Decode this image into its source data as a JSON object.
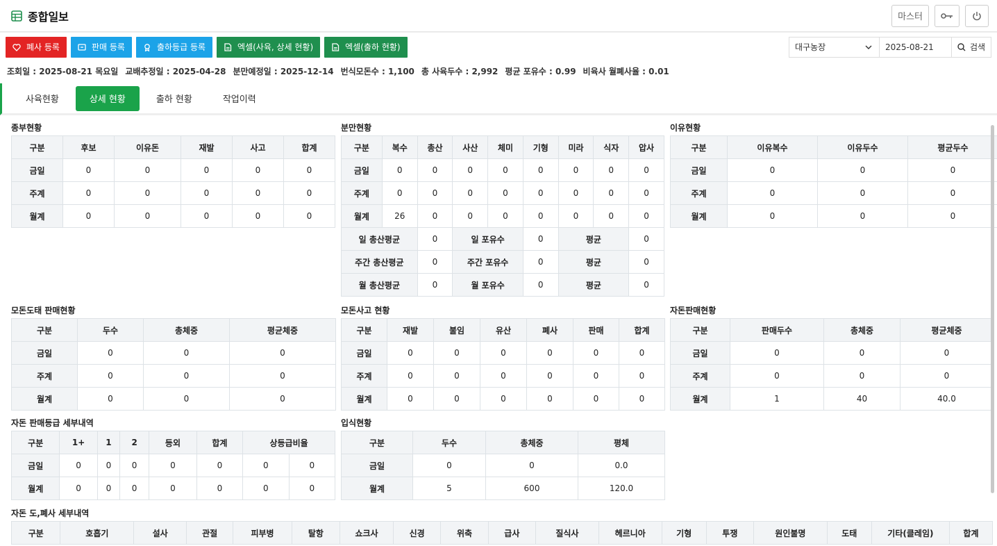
{
  "app": {
    "title": "종합일보"
  },
  "topbar": {
    "master": "마스터"
  },
  "actions": [
    {
      "label": "폐사 등록",
      "color": "#e32424",
      "icon": "heart-icon"
    },
    {
      "label": "판매 등록",
      "color": "#1ca3e8",
      "icon": "sale-icon"
    },
    {
      "label": "출하등급 등록",
      "color": "#1ca3e8",
      "icon": "badge-icon"
    },
    {
      "label": "엑셀(사육, 상세 현황)",
      "color": "#1f8f4e",
      "icon": "excel-icon"
    },
    {
      "label": "엑셀(출하 현황)",
      "color": "#1f8f4e",
      "icon": "excel-icon"
    }
  ],
  "search": {
    "farm": "대구농장",
    "date": "2025-08-21",
    "button": "검색"
  },
  "info": [
    "조회일 : 2025-08-21 목요일",
    "교배추정일 : 2025-04-28",
    "분만예정일 : 2025-12-14",
    "번식모돈수 : 1,100",
    "총 사육두수 : 2,992",
    "평균 포유수 : 0.99",
    "비육사 월폐사율 : 0.01"
  ],
  "tabs": [
    "사육현황",
    "상세 현황",
    "출하 현황",
    "작업이력"
  ],
  "tables": {
    "t1": {
      "title": "종부현황",
      "head": [
        "구분",
        "후보",
        "이유돈",
        "재발",
        "사고",
        "합계"
      ],
      "rows": [
        [
          "금일",
          "0",
          "0",
          "0",
          "0",
          "0"
        ],
        [
          "주계",
          "0",
          "0",
          "0",
          "0",
          "0"
        ],
        [
          "월계",
          "0",
          "0",
          "0",
          "0",
          "0"
        ]
      ]
    },
    "t2": {
      "title": "분만현황",
      "head": [
        "구분",
        "복수",
        "총산",
        "사산",
        "체미",
        "기형",
        "미라",
        "식자",
        "압사"
      ],
      "rows": [
        [
          "금일",
          "0",
          "0",
          "0",
          "0",
          "0",
          "0",
          "0",
          "0"
        ],
        [
          "주계",
          "0",
          "0",
          "0",
          "0",
          "0",
          "0",
          "0",
          "0"
        ],
        [
          "월계",
          "26",
          "0",
          "0",
          "0",
          "0",
          "0",
          "0",
          "0"
        ]
      ],
      "extra": [
        [
          "일 총산평균",
          "0",
          "일 포유수",
          "0",
          "평균",
          "0"
        ],
        [
          "주간 총산평균",
          "0",
          "주간 포유수",
          "0",
          "평균",
          "0"
        ],
        [
          "월 총산평균",
          "0",
          "월 포유수",
          "0",
          "평균",
          "0"
        ]
      ]
    },
    "t3": {
      "title": "이유현황",
      "head": [
        "구분",
        "이유복수",
        "이유두수",
        "평균두수"
      ],
      "rows": [
        [
          "금일",
          "0",
          "0",
          "0"
        ],
        [
          "주계",
          "0",
          "0",
          "0"
        ],
        [
          "월계",
          "0",
          "0",
          "0"
        ]
      ]
    },
    "t4": {
      "title": "모돈도태 판매현황",
      "head": [
        "구분",
        "두수",
        "총체중",
        "평균체중"
      ],
      "rows": [
        [
          "금일",
          "0",
          "0",
          "0"
        ],
        [
          "주계",
          "0",
          "0",
          "0"
        ],
        [
          "월계",
          "0",
          "0",
          "0"
        ]
      ]
    },
    "t5": {
      "title": "모돈사고 현황",
      "head": [
        "구분",
        "재발",
        "불임",
        "유산",
        "폐사",
        "판매",
        "합계"
      ],
      "rows": [
        [
          "금일",
          "0",
          "0",
          "0",
          "0",
          "0",
          "0"
        ],
        [
          "주계",
          "0",
          "0",
          "0",
          "0",
          "0",
          "0"
        ],
        [
          "월계",
          "0",
          "0",
          "0",
          "0",
          "0",
          "0"
        ]
      ]
    },
    "t6": {
      "title": "자돈판매현황",
      "head": [
        "구분",
        "판매두수",
        "총체중",
        "평균체중"
      ],
      "rows": [
        [
          "금일",
          "0",
          "0",
          "0"
        ],
        [
          "주계",
          "0",
          "0",
          "0"
        ],
        [
          "월계",
          "1",
          "40",
          "40.0"
        ]
      ]
    },
    "t7": {
      "title": "자돈 판매등급 세부내역",
      "head": [
        "구분",
        "1+",
        "1",
        "2",
        "등외",
        "합계",
        "상등급비율"
      ],
      "rows": [
        [
          "금일",
          "0",
          "0",
          "0",
          "0",
          "0",
          "0",
          "0"
        ],
        [
          "월계",
          "0",
          "0",
          "0",
          "0",
          "0",
          "0",
          "0"
        ]
      ]
    },
    "t8": {
      "title": "입식현황",
      "head": [
        "구분",
        "두수",
        "총체중",
        "평체"
      ],
      "rows": [
        [
          "금일",
          "0",
          "0",
          "0.0"
        ],
        [
          "월계",
          "5",
          "600",
          "120.0"
        ]
      ]
    },
    "t9": {
      "title": "자돈 도,폐사 세부내역",
      "head": [
        "구분",
        "호흡기",
        "설사",
        "관절",
        "피부병",
        "탈항",
        "쇼크사",
        "신경",
        "위축",
        "급사",
        "질식사",
        "헤르니아",
        "기형",
        "투쟁",
        "원인불명",
        "도태",
        "기타(클레임)",
        "합계"
      ]
    }
  }
}
